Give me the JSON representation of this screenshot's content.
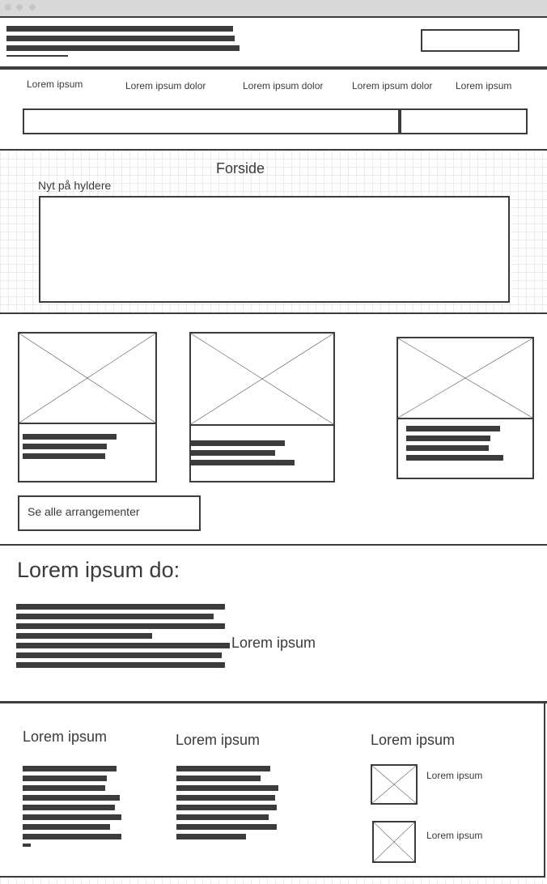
{
  "nav": {
    "items": [
      "Lorem ipsum",
      "Lorem ipsum dolor",
      "Lorem ipsum dolor",
      "Lorem ipsum dolor",
      "Lorem ipsum"
    ]
  },
  "hero": {
    "title": "Forside",
    "subtitle": "Nyt på hyldere"
  },
  "events": {
    "see_all_label": "Se alle arrangementer"
  },
  "info": {
    "heading": "Lorem ipsum do:",
    "side_label": "Lorem ipsum"
  },
  "footer": {
    "col1_heading": "Lorem ipsum",
    "col2_heading": "Lorem ipsum",
    "col3_heading": "Lorem ipsum",
    "item1_label": "Lorem ipsum",
    "item2_label": "Lorem ipsum"
  }
}
